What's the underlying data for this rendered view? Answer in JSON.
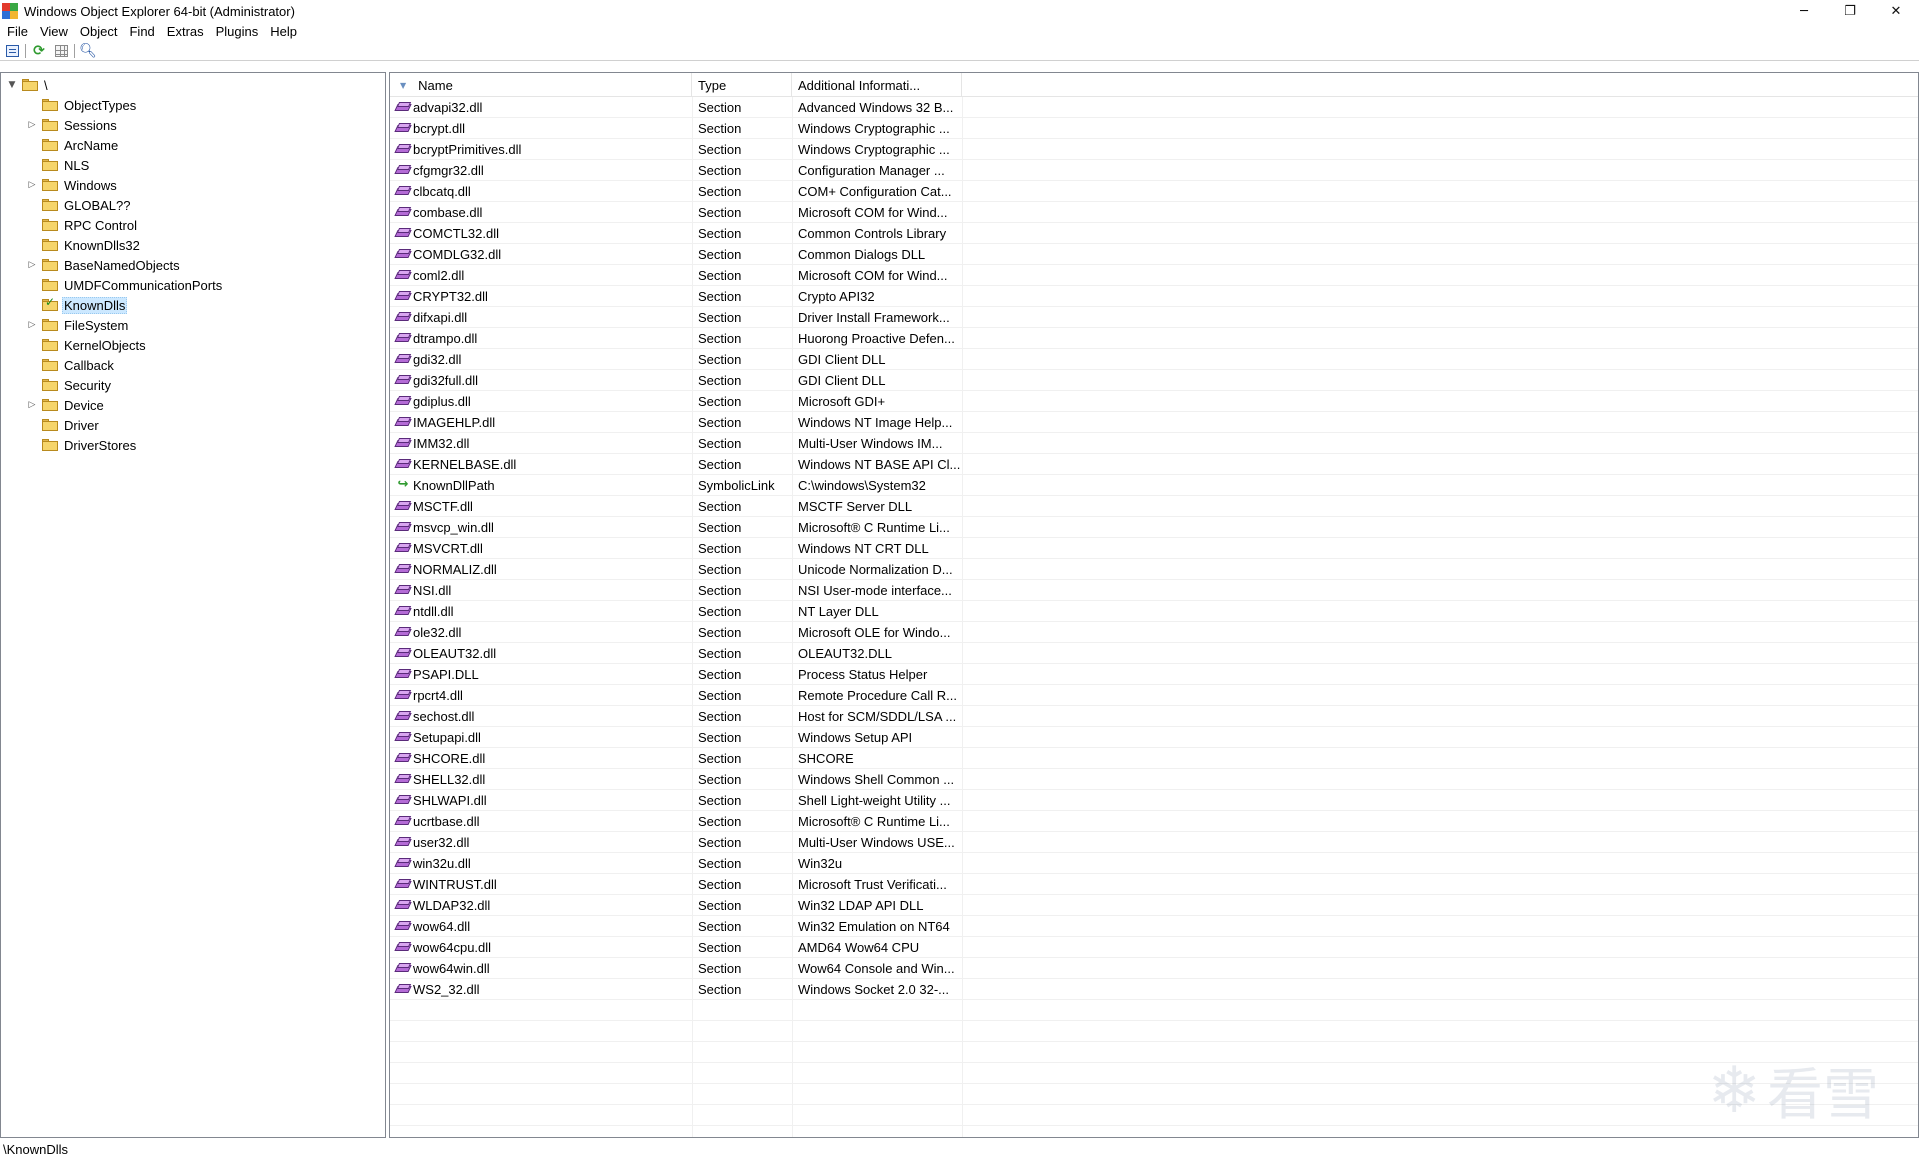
{
  "window": {
    "title": "Windows Object Explorer 64-bit (Administrator)",
    "minimize_glyph": "─",
    "restore_glyph": "❐",
    "close_glyph": "✕"
  },
  "menu": {
    "items": [
      "File",
      "View",
      "Object",
      "Find",
      "Extras",
      "Plugins",
      "Help"
    ]
  },
  "toolbar": {
    "buttons": [
      "properties-icon",
      "refresh-icon",
      "grid-icon",
      "search-icon"
    ]
  },
  "tree": {
    "root_label": "\\",
    "items": [
      {
        "label": "ObjectTypes",
        "expandable": false
      },
      {
        "label": "Sessions",
        "expandable": true
      },
      {
        "label": "ArcName",
        "expandable": false
      },
      {
        "label": "NLS",
        "expandable": false
      },
      {
        "label": "Windows",
        "expandable": true
      },
      {
        "label": "GLOBAL??",
        "expandable": false
      },
      {
        "label": "RPC Control",
        "expandable": false
      },
      {
        "label": "KnownDlls32",
        "expandable": false
      },
      {
        "label": "BaseNamedObjects",
        "expandable": true
      },
      {
        "label": "UMDFCommunicationPorts",
        "expandable": false
      },
      {
        "label": "KnownDlls",
        "expandable": false,
        "selected": true
      },
      {
        "label": "FileSystem",
        "expandable": true
      },
      {
        "label": "KernelObjects",
        "expandable": false
      },
      {
        "label": "Callback",
        "expandable": false
      },
      {
        "label": "Security",
        "expandable": false
      },
      {
        "label": "Device",
        "expandable": true
      },
      {
        "label": "Driver",
        "expandable": false
      },
      {
        "label": "DriverStores",
        "expandable": false
      }
    ]
  },
  "list": {
    "headers": {
      "name": "Name",
      "type": "Type",
      "info": "Additional Informati..."
    },
    "rows": [
      {
        "name": "advapi32.dll",
        "type": "Section",
        "info": "Advanced Windows 32 B...",
        "icon": "section"
      },
      {
        "name": "bcrypt.dll",
        "type": "Section",
        "info": "Windows Cryptographic ...",
        "icon": "section"
      },
      {
        "name": "bcryptPrimitives.dll",
        "type": "Section",
        "info": "Windows Cryptographic ...",
        "icon": "section"
      },
      {
        "name": "cfgmgr32.dll",
        "type": "Section",
        "info": "Configuration Manager ...",
        "icon": "section"
      },
      {
        "name": "clbcatq.dll",
        "type": "Section",
        "info": "COM+ Configuration Cat...",
        "icon": "section"
      },
      {
        "name": "combase.dll",
        "type": "Section",
        "info": "Microsoft COM for Wind...",
        "icon": "section"
      },
      {
        "name": "COMCTL32.dll",
        "type": "Section",
        "info": "Common Controls Library",
        "icon": "section"
      },
      {
        "name": "COMDLG32.dll",
        "type": "Section",
        "info": "Common Dialogs DLL",
        "icon": "section"
      },
      {
        "name": "coml2.dll",
        "type": "Section",
        "info": "Microsoft COM for Wind...",
        "icon": "section"
      },
      {
        "name": "CRYPT32.dll",
        "type": "Section",
        "info": "Crypto API32",
        "icon": "section"
      },
      {
        "name": "difxapi.dll",
        "type": "Section",
        "info": "Driver Install Framework...",
        "icon": "section"
      },
      {
        "name": "dtrampo.dll",
        "type": "Section",
        "info": "Huorong Proactive Defen...",
        "icon": "section"
      },
      {
        "name": "gdi32.dll",
        "type": "Section",
        "info": "GDI Client DLL",
        "icon": "section"
      },
      {
        "name": "gdi32full.dll",
        "type": "Section",
        "info": "GDI Client DLL",
        "icon": "section"
      },
      {
        "name": "gdiplus.dll",
        "type": "Section",
        "info": "Microsoft GDI+",
        "icon": "section"
      },
      {
        "name": "IMAGEHLP.dll",
        "type": "Section",
        "info": "Windows NT Image Help...",
        "icon": "section"
      },
      {
        "name": "IMM32.dll",
        "type": "Section",
        "info": "Multi-User Windows IM...",
        "icon": "section"
      },
      {
        "name": "KERNELBASE.dll",
        "type": "Section",
        "info": "Windows NT BASE API Cl...",
        "icon": "section"
      },
      {
        "name": "KnownDllPath",
        "type": "SymbolicLink",
        "info": "C:\\windows\\System32",
        "icon": "symlink"
      },
      {
        "name": "MSCTF.dll",
        "type": "Section",
        "info": "MSCTF Server DLL",
        "icon": "section"
      },
      {
        "name": "msvcp_win.dll",
        "type": "Section",
        "info": "Microsoft® C Runtime Li...",
        "icon": "section"
      },
      {
        "name": "MSVCRT.dll",
        "type": "Section",
        "info": "Windows NT CRT DLL",
        "icon": "section"
      },
      {
        "name": "NORMALIZ.dll",
        "type": "Section",
        "info": "Unicode Normalization D...",
        "icon": "section"
      },
      {
        "name": "NSI.dll",
        "type": "Section",
        "info": "NSI User-mode interface...",
        "icon": "section"
      },
      {
        "name": "ntdll.dll",
        "type": "Section",
        "info": "NT Layer DLL",
        "icon": "section"
      },
      {
        "name": "ole32.dll",
        "type": "Section",
        "info": "Microsoft OLE for Windo...",
        "icon": "section"
      },
      {
        "name": "OLEAUT32.dll",
        "type": "Section",
        "info": "OLEAUT32.DLL",
        "icon": "section"
      },
      {
        "name": "PSAPI.DLL",
        "type": "Section",
        "info": "Process Status Helper",
        "icon": "section"
      },
      {
        "name": "rpcrt4.dll",
        "type": "Section",
        "info": "Remote Procedure Call R...",
        "icon": "section"
      },
      {
        "name": "sechost.dll",
        "type": "Section",
        "info": "Host for SCM/SDDL/LSA ...",
        "icon": "section"
      },
      {
        "name": "Setupapi.dll",
        "type": "Section",
        "info": "Windows Setup API",
        "icon": "section"
      },
      {
        "name": "SHCORE.dll",
        "type": "Section",
        "info": "SHCORE",
        "icon": "section"
      },
      {
        "name": "SHELL32.dll",
        "type": "Section",
        "info": "Windows Shell Common ...",
        "icon": "section"
      },
      {
        "name": "SHLWAPI.dll",
        "type": "Section",
        "info": "Shell Light-weight Utility ...",
        "icon": "section"
      },
      {
        "name": "ucrtbase.dll",
        "type": "Section",
        "info": "Microsoft® C Runtime Li...",
        "icon": "section"
      },
      {
        "name": "user32.dll",
        "type": "Section",
        "info": "Multi-User Windows USE...",
        "icon": "section"
      },
      {
        "name": "win32u.dll",
        "type": "Section",
        "info": "Win32u",
        "icon": "section"
      },
      {
        "name": "WINTRUST.dll",
        "type": "Section",
        "info": "Microsoft Trust Verificati...",
        "icon": "section"
      },
      {
        "name": "WLDAP32.dll",
        "type": "Section",
        "info": "Win32 LDAP API DLL",
        "icon": "section"
      },
      {
        "name": "wow64.dll",
        "type": "Section",
        "info": "Win32 Emulation on NT64",
        "icon": "section"
      },
      {
        "name": "wow64cpu.dll",
        "type": "Section",
        "info": "AMD64 Wow64 CPU",
        "icon": "section"
      },
      {
        "name": "wow64win.dll",
        "type": "Section",
        "info": "Wow64 Console and Win...",
        "icon": "section"
      },
      {
        "name": "WS2_32.dll",
        "type": "Section",
        "info": "Windows Socket 2.0 32-...",
        "icon": "section"
      }
    ]
  },
  "watermark": {
    "text": "看雪"
  },
  "status": {
    "path": "\\KnownDlls"
  }
}
